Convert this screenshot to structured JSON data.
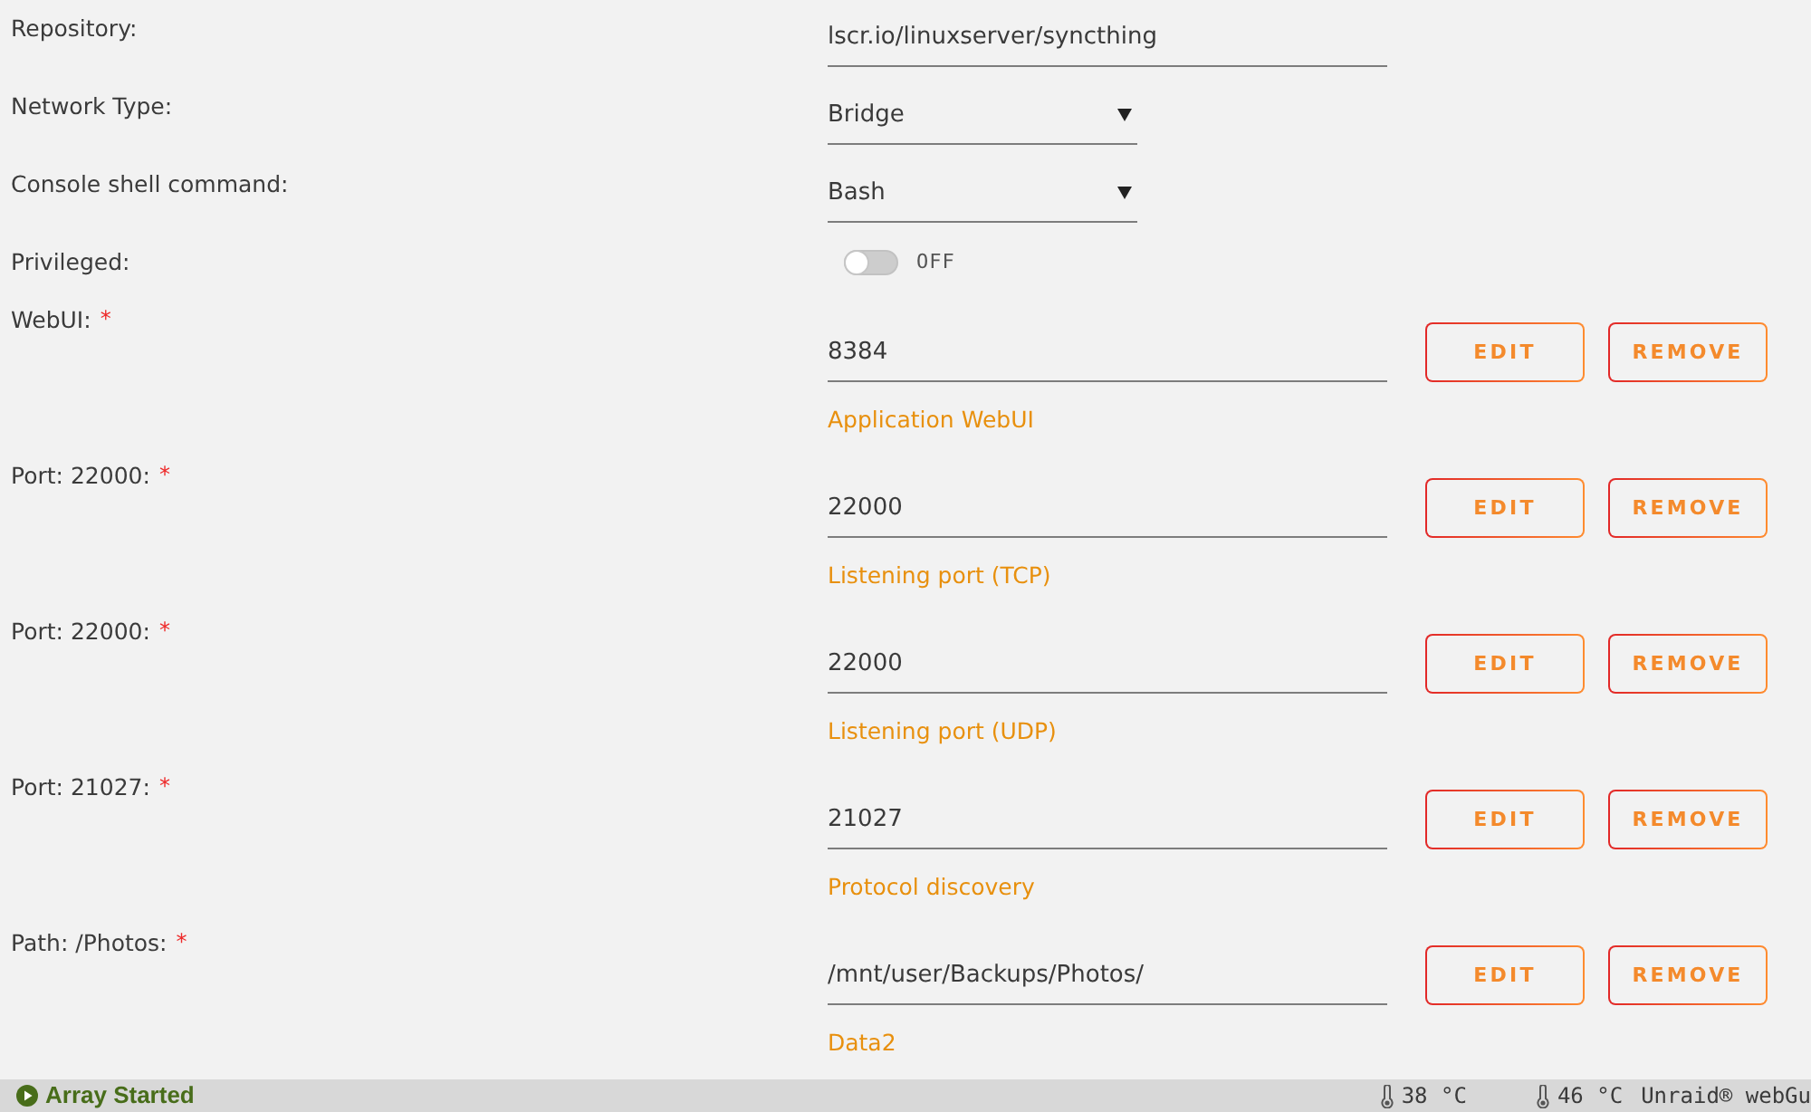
{
  "settings": [
    {
      "kind": "text",
      "label": "Repository:",
      "value": "lscr.io/linuxserver/syncthing"
    },
    {
      "kind": "select",
      "label": "Network Type:",
      "value": "Bridge"
    },
    {
      "kind": "select",
      "label": "Console shell command:",
      "value": "Bash"
    },
    {
      "kind": "toggle",
      "label": "Privileged:",
      "on": false,
      "state_text": "OFF"
    }
  ],
  "configs": [
    {
      "label": "WebUI:",
      "required_mark": "*",
      "value": "8384",
      "description": "Application WebUI",
      "buttons": [
        "EDIT",
        "REMOVE"
      ]
    },
    {
      "label": "Port: 22000:",
      "required_mark": "*",
      "value": "22000",
      "description": "Listening port (TCP)",
      "buttons": [
        "EDIT",
        "REMOVE"
      ]
    },
    {
      "label": "Port: 22000:",
      "required_mark": "*",
      "value": "22000",
      "description": "Listening port (UDP)",
      "buttons": [
        "EDIT",
        "REMOVE"
      ]
    },
    {
      "label": "Port: 21027:",
      "required_mark": "*",
      "value": "21027",
      "description": "Protocol discovery",
      "buttons": [
        "EDIT",
        "REMOVE"
      ]
    },
    {
      "label": "Path: /Photos:",
      "required_mark": "*",
      "value": "/mnt/user/Backups/Photos/",
      "description": "Data2",
      "buttons": [
        "EDIT",
        "REMOVE"
      ]
    }
  ],
  "status_bar": {
    "array_status": "Array Started",
    "temperatures": [
      "38 °C",
      "46 °C"
    ],
    "footer_text": "Unraid® webGu"
  }
}
